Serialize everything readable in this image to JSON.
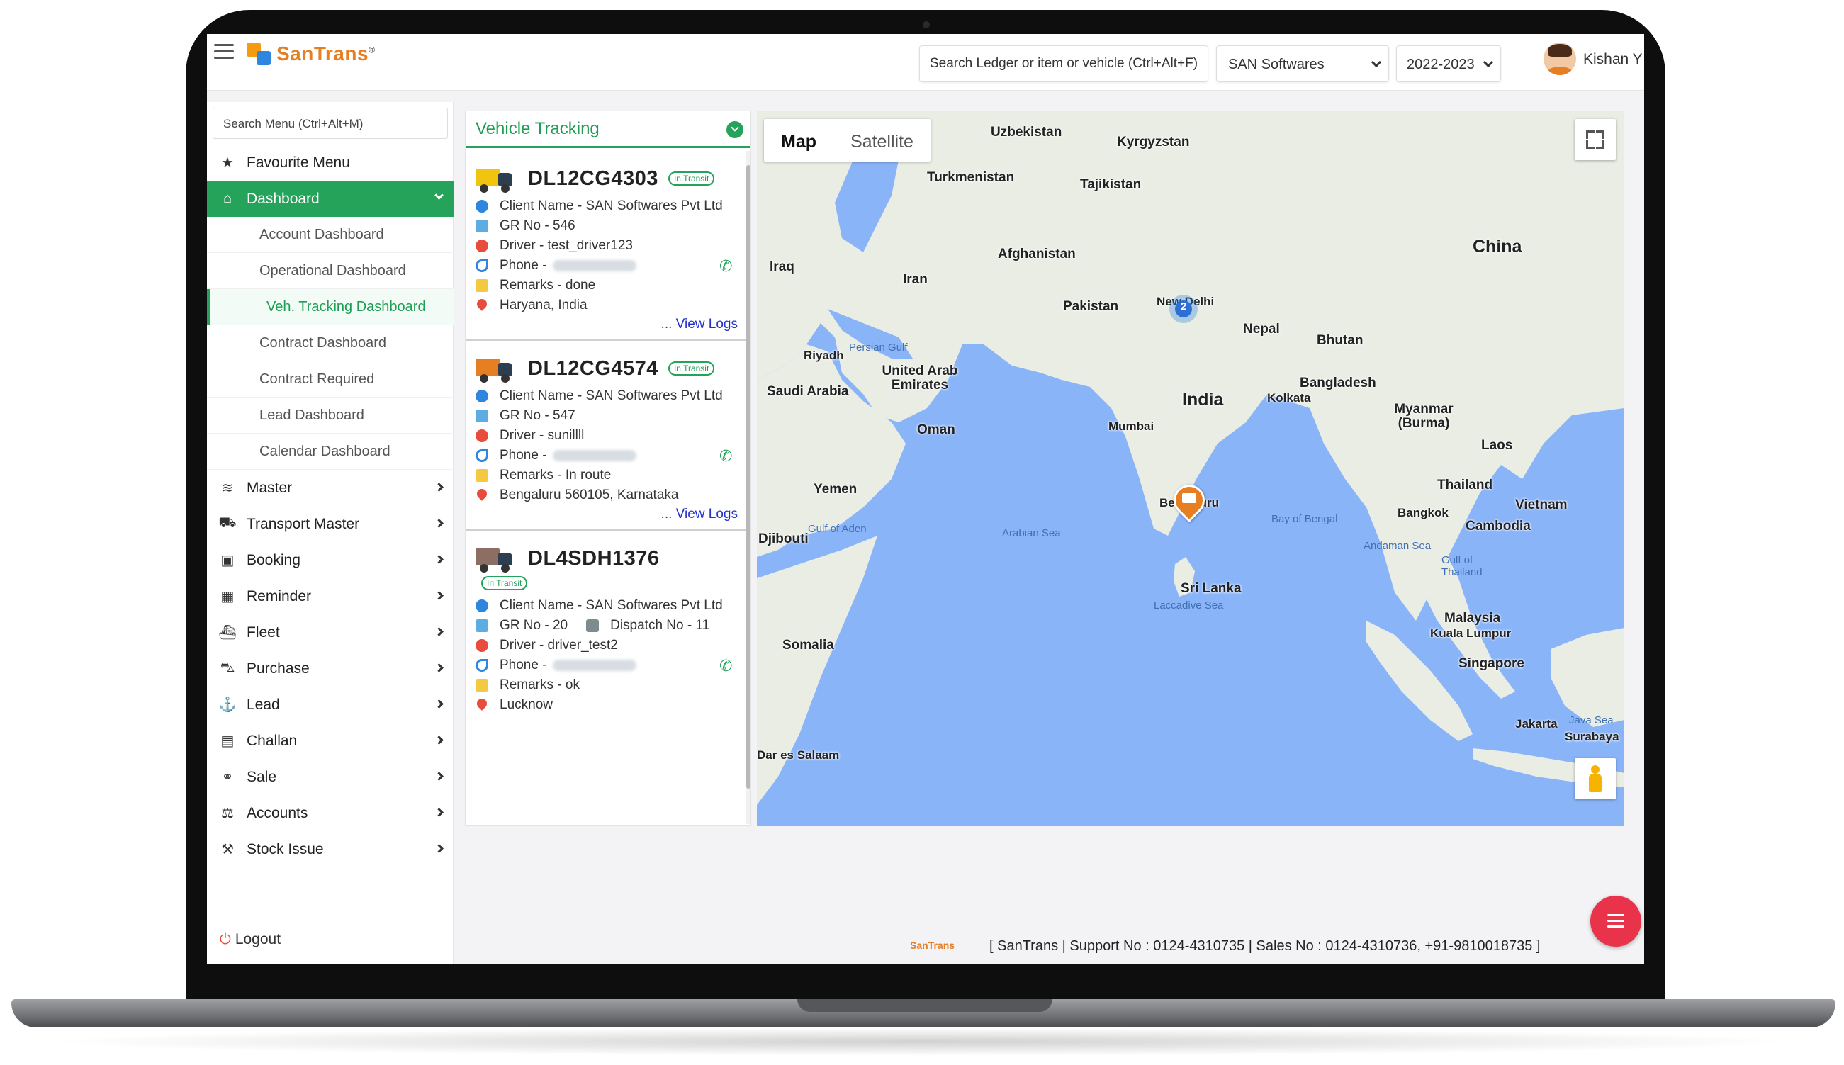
{
  "brand": {
    "name": "SanTrans",
    "reg": "®"
  },
  "header": {
    "search_placeholder": "Search Ledger or item or vehicle (Ctrl+Alt+F)",
    "company": "SAN Softwares",
    "year": "2022-2023",
    "user": "Kishan Y"
  },
  "sidebar": {
    "search_placeholder": "Search Menu (Ctrl+Alt+M)",
    "favourite": "Favourite Menu",
    "dashboard": "Dashboard",
    "dashboard_items": [
      "Account Dashboard",
      "Operational Dashboard",
      "Veh. Tracking Dashboard",
      "Contract Dashboard",
      "Contract Required",
      "Lead Dashboard",
      "Calendar Dashboard"
    ],
    "items": [
      "Master",
      "Transport Master",
      "Booking",
      "Reminder",
      "Fleet",
      "Purchase",
      "Lead",
      "Challan",
      "Sale",
      "Accounts",
      "Stock Issue"
    ],
    "logout": "Logout"
  },
  "vehicle_panel": {
    "title": "Vehicle Tracking",
    "badge": "In Transit",
    "view_logs_prefix": "...",
    "view_logs": "View Logs",
    "cards": [
      {
        "vehicle": "DL12CG4303",
        "client": "Client Name - SAN Softwares Pvt Ltd",
        "gr": "GR No - 546",
        "driver": "Driver - test_driver123",
        "phone": "Phone -",
        "remarks": "Remarks - done",
        "location": "Haryana, India"
      },
      {
        "vehicle": "DL12CG4574",
        "client": "Client Name - SAN Softwares Pvt Ltd",
        "gr": "GR No - 547",
        "driver": "Driver - sunillll",
        "phone": "Phone -",
        "remarks": "Remarks - In route",
        "location": "Bengaluru 560105, Karnataka"
      },
      {
        "vehicle": "DL4SDH1376",
        "client": "Client Name - SAN Softwares Pvt Ltd",
        "gr": "GR No - 20",
        "dispatch": "Dispatch No - 11",
        "driver": "Driver - driver_test2",
        "phone": "Phone -",
        "remarks": "Remarks - ok",
        "location": "Lucknow"
      }
    ]
  },
  "map": {
    "type_map": "Map",
    "type_satellite": "Satellite",
    "cluster_count": "2",
    "labels": {
      "uzbekistan": "Uzbekistan",
      "kyrgyzstan": "Kyrgyzstan",
      "turkmenistan": "Turkmenistan",
      "tajikistan": "Tajikistan",
      "china": "China",
      "afghanistan": "Afghanistan",
      "iraq": "Iraq",
      "iran": "Iran",
      "pakistan": "Pakistan",
      "new_delhi": "New Delhi",
      "nepal": "Nepal",
      "bhutan": "Bhutan",
      "riyadh": "Riyadh",
      "persian_gulf": "Persian Gulf",
      "uae": "United Arab Emirates",
      "saudi_arabia": "Saudi Arabia",
      "bangladesh": "Bangladesh",
      "india": "India",
      "kolkata": "Kolkata",
      "myanmar": "Myanmar (Burma)",
      "oman": "Oman",
      "mumbai": "Mumbai",
      "laos": "Laos",
      "yemen": "Yemen",
      "thailand": "Thailand",
      "bangkok": "Bangkok",
      "vietnam": "Vietnam",
      "cambodia": "Cambodia",
      "gulf_aden": "Gulf of Aden",
      "arabian_sea": "Arabian Sea",
      "bay_bengal": "Bay of Bengal",
      "andaman": "Andaman Sea",
      "gulf_thailand": "Gulf of Thailand",
      "djibouti": "Djibouti",
      "bengaluru": "Bengaluru",
      "sri_lanka": "Sri Lanka",
      "laccadive": "Laccadive Sea",
      "malaysia": "Malaysia",
      "kuala_lumpur": "Kuala Lumpur",
      "somalia": "Somalia",
      "singapore": "Singapore",
      "dar": "Dar es Salaam",
      "jakarta": "Jakarta",
      "java_sea": "Java Sea",
      "surabaya": "Surabaya"
    }
  },
  "footer": {
    "logo": "SanTrans",
    "text": "[ SanTrans | Support No : 0124-4310735 | Sales No : 0124-4310736, +91-9810018735 ]"
  },
  "colors": {
    "accent": "#25a35a",
    "brand_orange": "#e67e22",
    "fab": "#e8334a",
    "water": "#8ab4f8",
    "land": "#e9ede4"
  }
}
